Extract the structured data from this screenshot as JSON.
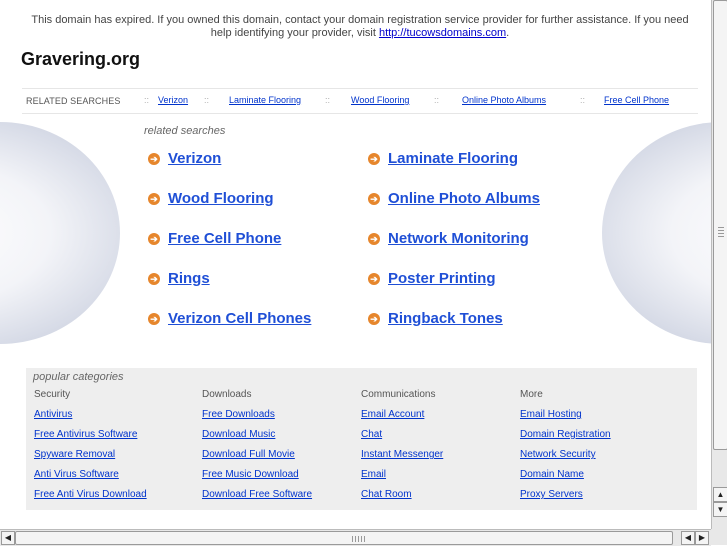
{
  "notice": {
    "text": "This domain has expired. If you owned this domain, contact your domain registration service provider for further assistance. If you need help identifying your provider, visit ",
    "link": "http://tucowsdomains.com",
    "tail": "."
  },
  "site_title": "Gravering.org",
  "related_bar": {
    "label": "RELATED SEARCHES",
    "separator": "::",
    "links": [
      "Verizon",
      "Laminate Flooring",
      "Wood Flooring",
      "Online Photo Albums",
      "Free Cell Phone"
    ]
  },
  "related_searches": {
    "caption": "related searches",
    "arrow": "➔",
    "items": [
      "Verizon",
      "Laminate Flooring",
      "Wood Flooring",
      "Online Photo Albums",
      "Free Cell Phone",
      "Network Monitoring",
      "Rings",
      "Poster Printing",
      "Verizon Cell Phones",
      "Ringback Tones"
    ]
  },
  "popular": {
    "caption": "popular categories",
    "columns": [
      {
        "header": "Security",
        "links": [
          "Antivirus",
          "Free Antivirus Software",
          "Spyware Removal",
          "Anti Virus Software",
          "Free Anti Virus Download"
        ]
      },
      {
        "header": "Downloads",
        "links": [
          "Free Downloads",
          "Download Music",
          "Download Full Movie",
          "Free Music Download",
          "Download Free Software"
        ]
      },
      {
        "header": "Communications",
        "links": [
          "Email Account",
          "Chat",
          "Instant Messenger",
          "Email",
          "Chat Room"
        ]
      },
      {
        "header": "More",
        "links": [
          "Email Hosting",
          "Domain Registration",
          "Network Security",
          "Domain Name",
          "Proxy Servers"
        ]
      }
    ]
  },
  "scrollbars": {
    "up_arrow": "▲",
    "down_arrow": "▼",
    "left_arrow": "◀",
    "right_arrow": "▶"
  },
  "colors": {
    "link": "#1f4fd6",
    "arrow": "#e6862c",
    "panel": "#eeeeee"
  }
}
